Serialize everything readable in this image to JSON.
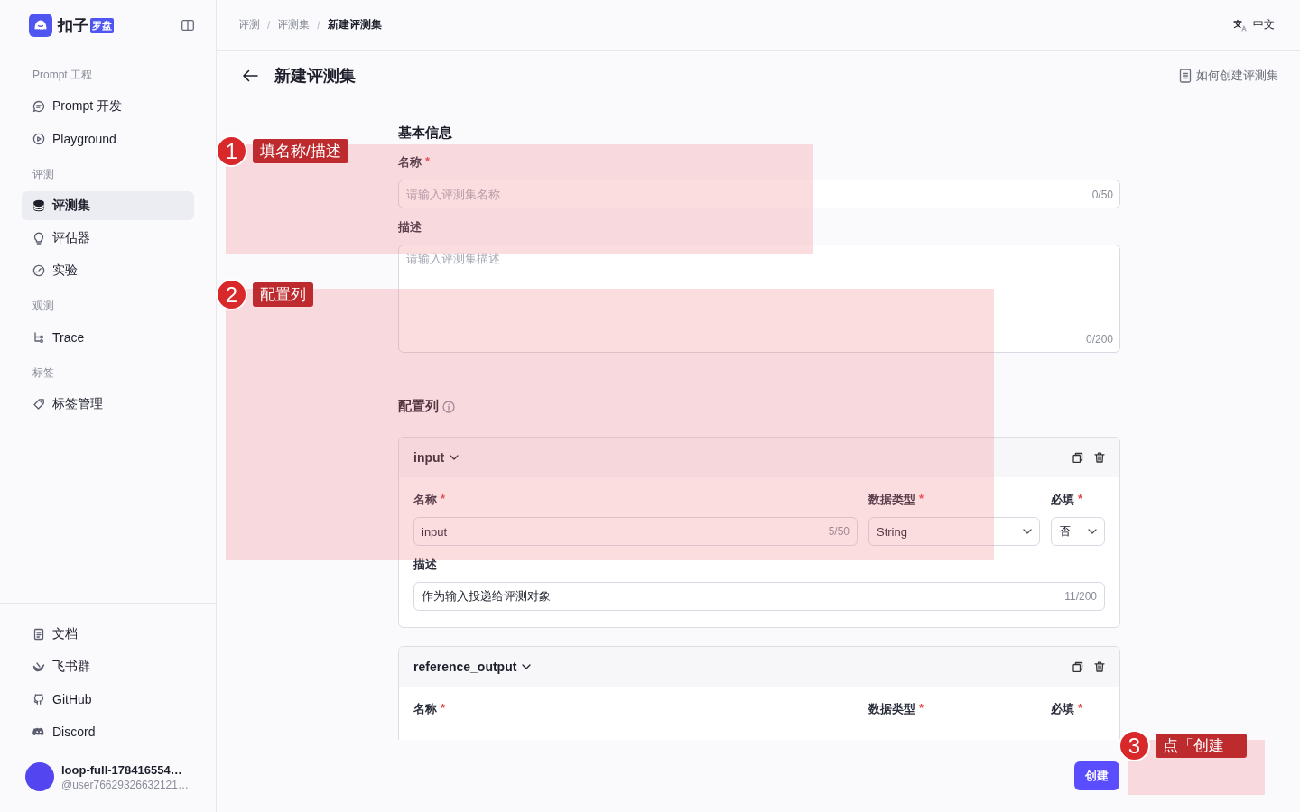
{
  "sidebar": {
    "logo": {
      "text": "扣子",
      "badge": "罗盘"
    },
    "sections": [
      {
        "title": "Prompt 工程",
        "items": [
          {
            "label": "Prompt 开发",
            "selected": false
          },
          {
            "label": "Playground",
            "selected": false
          }
        ]
      },
      {
        "title": "评测",
        "items": [
          {
            "label": "评测集",
            "selected": true
          },
          {
            "label": "评估器",
            "selected": false
          },
          {
            "label": "实验",
            "selected": false
          }
        ]
      },
      {
        "title": "观测",
        "items": [
          {
            "label": "Trace",
            "selected": false
          }
        ]
      },
      {
        "title": "标签",
        "items": [
          {
            "label": "标签管理",
            "selected": false
          }
        ]
      }
    ],
    "bottom_items": [
      {
        "label": "文档"
      },
      {
        "label": "飞书群"
      },
      {
        "label": "GitHub"
      },
      {
        "label": "Discord"
      }
    ],
    "user": {
      "name": "loop-full-178416554…",
      "handle": "@user76629326632121…"
    }
  },
  "header": {
    "breadcrumbs": [
      {
        "label": "评测",
        "current": false
      },
      {
        "separator": "/",
        "label": "评测集",
        "current": false
      },
      {
        "separator": "/",
        "label": "新建评测集",
        "current": true
      }
    ],
    "language": "中文"
  },
  "page": {
    "title": "新建评测集",
    "help_link": "如何创建评测集"
  },
  "form": {
    "basic_title": "基本信息",
    "name": {
      "label": "名称",
      "required_mark": "*",
      "placeholder": "请输入评测集名称",
      "count": "0/50"
    },
    "description": {
      "label": "描述",
      "placeholder": "请输入评测集描述",
      "count": "0/200"
    },
    "columns_title": "配置列",
    "columns": [
      {
        "title": "input",
        "expanded": true,
        "name_label": "名称",
        "name_mark": "*",
        "name_value": "input",
        "name_count": "5/50",
        "type_label": "数据类型",
        "type_mark": "*",
        "type_value": "String",
        "required_label": "必填",
        "required_mark": "*",
        "required_value": "否",
        "desc_label": "描述",
        "desc_value": "作为输入投递给评测对象",
        "desc_count": "11/200"
      },
      {
        "title": "reference_output",
        "expanded": true,
        "name_label": "名称",
        "name_mark": "*",
        "type_label": "数据类型",
        "type_mark": "*",
        "required_label": "必填",
        "required_mark": "*"
      }
    ]
  },
  "footer": {
    "create_button": "创建"
  },
  "annotations": [
    {
      "number": "1",
      "label": "填名称/描述"
    },
    {
      "number": "2",
      "label": "配置列"
    },
    {
      "number": "3",
      "label": "点「创建」"
    }
  ]
}
